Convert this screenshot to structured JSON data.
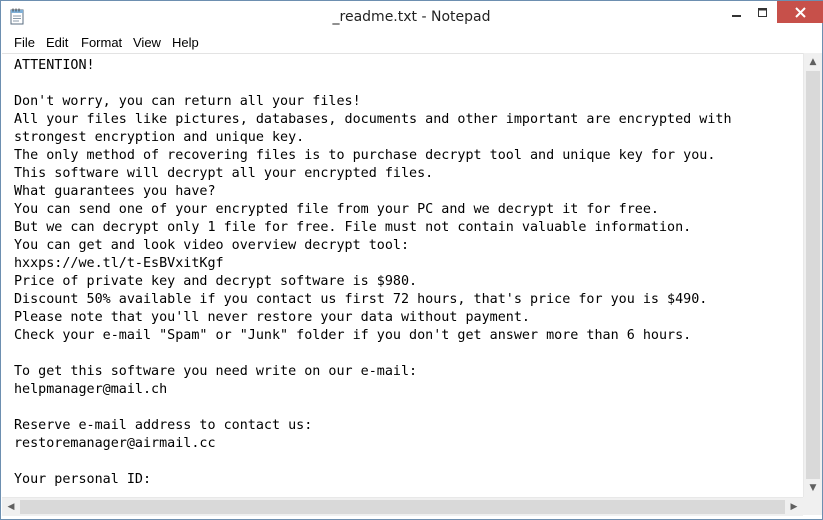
{
  "window": {
    "title": "_readme.txt - Notepad",
    "close_color": "#c7504a"
  },
  "menu": {
    "items": [
      "File",
      "Edit",
      "Format",
      "View",
      "Help"
    ]
  },
  "document": {
    "content": "ATTENTION!\n\nDon't worry, you can return all your files!\nAll your files like pictures, databases, documents and other important are encrypted with\nstrongest encryption and unique key.\nThe only method of recovering files is to purchase decrypt tool and unique key for you.\nThis software will decrypt all your encrypted files.\nWhat guarantees you have?\nYou can send one of your encrypted file from your PC and we decrypt it for free.\nBut we can decrypt only 1 file for free. File must not contain valuable information.\nYou can get and look video overview decrypt tool:\nhxxps://we.tl/t-EsBVxitKgf\nPrice of private key and decrypt software is $980.\nDiscount 50% available if you contact us first 72 hours, that's price for you is $490.\nPlease note that you'll never restore your data without payment.\nCheck your e-mail \"Spam\" or \"Junk\" folder if you don't get answer more than 6 hours.\n\nTo get this software you need write on our e-mail:\nhelpmanager@mail.ch\n\nReserve e-mail address to contact us:\nrestoremanager@airmail.cc\n\nYour personal ID:"
  },
  "icons": {
    "app": "notepad-icon",
    "minimize": "minimize-icon",
    "maximize": "maximize-icon",
    "close": "close-icon",
    "scroll_up": "scroll-up-icon",
    "scroll_down": "scroll-down-icon",
    "scroll_left": "scroll-left-icon",
    "scroll_right": "scroll-right-icon"
  }
}
